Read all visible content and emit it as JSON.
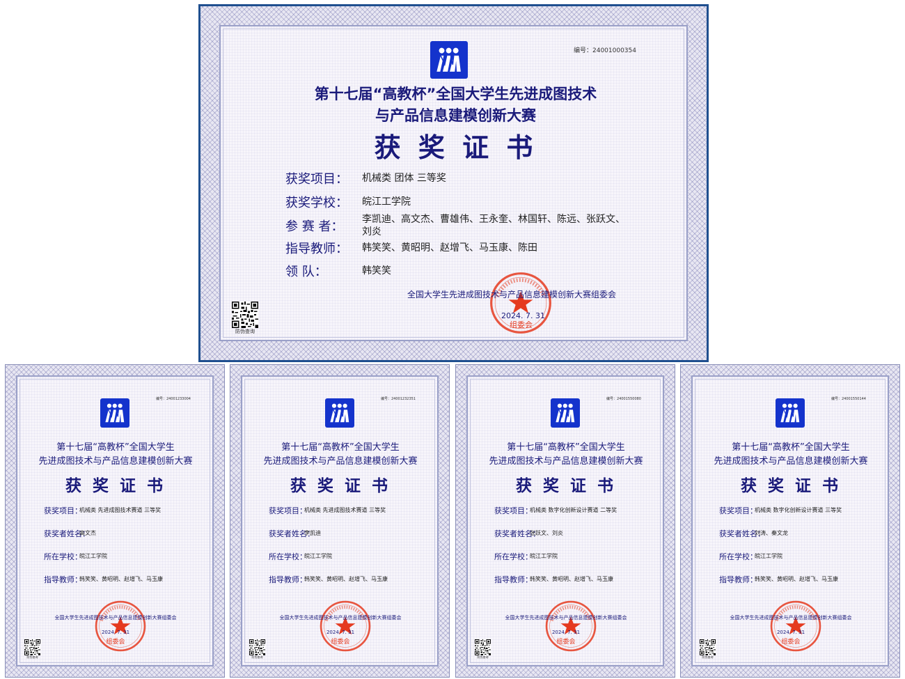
{
  "main": {
    "serial": "编号：24001000354",
    "title_line1": "第十七届“高教杯”全国大学生先进成图技术",
    "title_line2": "与产品信息建模创新大赛",
    "heading": "获 奖 证 书",
    "fields": {
      "project_label": "获奖项目：",
      "project_value": "机械类  团体  三等奖",
      "school_label": "获奖学校：",
      "school_value": "皖江工学院",
      "participants_label": "参  赛  者：",
      "participants_line1": "李凯迪、高文杰、曹雄伟、王永奎、林国轩、陈远、张跃文、",
      "participants_line2": "刘炎",
      "advisor_label": "指导教师：",
      "advisor_value": "韩笑笑、黄昭明、赵增飞、马玉康、陈田",
      "leader_label": "领        队：",
      "leader_value": "韩笑笑"
    },
    "organizer": "全国大学生先进成图技术与产品信息建模创新大赛组委会",
    "date": "2024. 7. 31",
    "seal_text": "组委会",
    "qr_label": "防伪查询"
  },
  "small_certs": [
    {
      "serial": "编号：24001233004",
      "title_line1": "第十七届“高教杯”全国大学生",
      "title_line2": "先进成图技术与产品信息建模创新大赛",
      "heading": "获 奖 证 书",
      "project_label": "获奖项目：",
      "project_value": "机械类  先进成图技术赛道  三等奖",
      "winner_label": "获奖者姓名：",
      "winner_value": "高文杰",
      "school_label": "所在学校：",
      "school_value": "皖江工学院",
      "advisor_label": "指导教师：",
      "advisor_value": "韩笑笑、黄昭明、赵增飞、马玉康",
      "organizer": "全国大学生先进成图技术与产品信息建模创新大赛组委会",
      "date": "2024. 7. 31",
      "seal_text": "组委会",
      "qr_label": "防伪查询"
    },
    {
      "serial": "编号：24001232351",
      "title_line1": "第十七届“高教杯”全国大学生",
      "title_line2": "先进成图技术与产品信息建模创新大赛",
      "heading": "获 奖 证 书",
      "project_label": "获奖项目：",
      "project_value": "机械类  先进成图技术赛道  三等奖",
      "winner_label": "获奖者姓名：",
      "winner_value": "李凯迪",
      "school_label": "所在学校：",
      "school_value": "皖江工学院",
      "advisor_label": "指导教师：",
      "advisor_value": "韩笑笑、黄昭明、赵增飞、马玉康",
      "organizer": "全国大学生先进成图技术与产品信息建模创新大赛组委会",
      "date": "2024. 7. 31",
      "seal_text": "组委会",
      "qr_label": "防伪查询"
    },
    {
      "serial": "编号：24001550080",
      "title_line1": "第十七届“高教杯”全国大学生",
      "title_line2": "先进成图技术与产品信息建模创新大赛",
      "heading": "获 奖 证 书",
      "project_label": "获奖项目：",
      "project_value": "机械类  数字化创新设计赛道  二等奖",
      "winner_label": "获奖者姓名：",
      "winner_value": "张跃文、刘炎",
      "school_label": "所在学校：",
      "school_value": "皖江工学院",
      "advisor_label": "指导教师：",
      "advisor_value": "韩笑笑、黄昭明、赵增飞、马玉康",
      "organizer": "全国大学生先进成图技术与产品信息建模创新大赛组委会",
      "date": "2024. 7. 31",
      "seal_text": "组委会",
      "qr_label": "防伪查询"
    },
    {
      "serial": "编号：24001550144",
      "title_line1": "第十七届“高教杯”全国大学生",
      "title_line2": "先进成图技术与产品信息建模创新大赛",
      "heading": "获 奖 证 书",
      "project_label": "获奖项目：",
      "project_value": "机械类  数字化创新设计赛道  三等奖",
      "winner_label": "获奖者姓名：",
      "winner_value": "刘涛、秦文龙",
      "school_label": "所在学校：",
      "school_value": "皖江工学院",
      "advisor_label": "指导教师：",
      "advisor_value": "韩笑笑、黄昭明、赵增飞、马玉康",
      "organizer": "全国大学生先进成图技术与产品信息建模创新大赛组委会",
      "date": "2024. 7. 31",
      "seal_text": "组委会",
      "qr_label": "防伪查询"
    }
  ],
  "colors": {
    "title": "#1a1a7a",
    "seal": "#e53a1f",
    "logo": "#1433cc",
    "frame": "#1f4f8f"
  },
  "icons": {
    "logo": "competition-logo-icon",
    "seal": "official-seal-icon",
    "qr": "qr-code-icon"
  }
}
